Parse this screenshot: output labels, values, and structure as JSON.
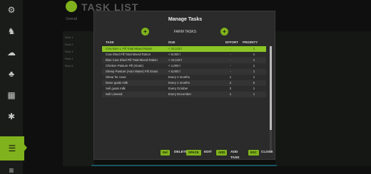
{
  "background": {
    "title": "TASK LIST",
    "subtitle": "Overall",
    "list_items": [
      "Row 1",
      "Row 2",
      "Row 3",
      "Row 4",
      "Row 5"
    ]
  },
  "modal": {
    "title": "Manage Tasks",
    "category": "FARM TASKS",
    "prev_category": "+",
    "next_category": "+",
    "columns": {
      "task": "TASK",
      "due": "DUE",
      "effort": "EFFORT",
      "priority": "PRIORITY"
    },
    "rows": [
      {
        "task": "Cow Barn L Fill Total Mixed Ration",
        "due": "< 10,125 l",
        "effort": "-",
        "priority": "1",
        "selected": true
      },
      {
        "task": "Cow Shed Fill Total Mixed Ration",
        "due": "< 8,000 l",
        "effort": "-",
        "priority": "1"
      },
      {
        "task": "Blue Cow Shed Fill Total Mixed Ration",
        "due": "< 10,125 l",
        "effort": "-",
        "priority": "1"
      },
      {
        "task": "Chicken Pasture Fill (Grain)",
        "due": "< 1,000 l",
        "effort": "-",
        "priority": "1"
      },
      {
        "task": "Sheep Pasture (Auto Water) Fill Grass",
        "due": "< 6,000 l",
        "effort": "-",
        "priority": "1"
      },
      {
        "task": "Shear for cows",
        "due": "Every 2 months",
        "effort": "1",
        "priority": "1"
      },
      {
        "task": "Move goats milk",
        "due": "Every 1 months",
        "effort": "2",
        "priority": "5"
      },
      {
        "task": "Sell goats milk",
        "due": "Every October",
        "effort": "2",
        "priority": "1"
      },
      {
        "task": "Sell Linseed",
        "due": "Every December",
        "effort": "1",
        "priority": "1"
      }
    ]
  },
  "footer": {
    "actions": [
      {
        "key": "Del",
        "label": "DELETE"
      },
      {
        "key": "SPACE",
        "label": "EDIT"
      },
      {
        "key": "ADD",
        "label": "ADD TASK"
      },
      {
        "key": "ESC",
        "label": "CLOSE"
      }
    ]
  },
  "colors": {
    "accent": "#7fb21c",
    "selected_row": "#8bc525",
    "modal_bg": "#2a2b2a"
  },
  "icons": [
    "tractor-icon",
    "cow-icon",
    "sheep-icon",
    "sprout-icon",
    "calendar-icon",
    "gear-icon",
    "list-icon",
    "checklist-icon"
  ]
}
